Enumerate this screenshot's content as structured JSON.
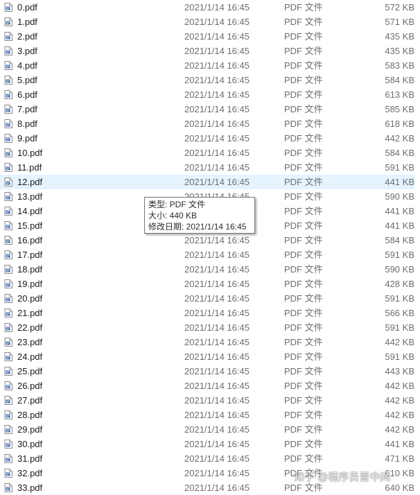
{
  "files": [
    {
      "name": "0.pdf",
      "date": "2021/1/14 16:45",
      "type": "PDF 文件",
      "size": "572 KB"
    },
    {
      "name": "1.pdf",
      "date": "2021/1/14 16:45",
      "type": "PDF 文件",
      "size": "571 KB"
    },
    {
      "name": "2.pdf",
      "date": "2021/1/14 16:45",
      "type": "PDF 文件",
      "size": "435 KB"
    },
    {
      "name": "3.pdf",
      "date": "2021/1/14 16:45",
      "type": "PDF 文件",
      "size": "435 KB"
    },
    {
      "name": "4.pdf",
      "date": "2021/1/14 16:45",
      "type": "PDF 文件",
      "size": "583 KB"
    },
    {
      "name": "5.pdf",
      "date": "2021/1/14 16:45",
      "type": "PDF 文件",
      "size": "584 KB"
    },
    {
      "name": "6.pdf",
      "date": "2021/1/14 16:45",
      "type": "PDF 文件",
      "size": "613 KB"
    },
    {
      "name": "7.pdf",
      "date": "2021/1/14 16:45",
      "type": "PDF 文件",
      "size": "585 KB"
    },
    {
      "name": "8.pdf",
      "date": "2021/1/14 16:45",
      "type": "PDF 文件",
      "size": "618 KB"
    },
    {
      "name": "9.pdf",
      "date": "2021/1/14 16:45",
      "type": "PDF 文件",
      "size": "442 KB"
    },
    {
      "name": "10.pdf",
      "date": "2021/1/14 16:45",
      "type": "PDF 文件",
      "size": "584 KB"
    },
    {
      "name": "11.pdf",
      "date": "2021/1/14 16:45",
      "type": "PDF 文件",
      "size": "591 KB"
    },
    {
      "name": "12.pdf",
      "date": "2021/1/14 16:45",
      "type": "PDF 文件",
      "size": "441 KB",
      "selected": true
    },
    {
      "name": "13.pdf",
      "date": "2021/1/14 16:45",
      "type": "PDF 文件",
      "size": "590 KB"
    },
    {
      "name": "14.pdf",
      "date": "2021/1/14 16:45",
      "type": "PDF 文件",
      "size": "441 KB"
    },
    {
      "name": "15.pdf",
      "date": "2021/1/14 16:45",
      "type": "PDF 文件",
      "size": "441 KB"
    },
    {
      "name": "16.pdf",
      "date": "2021/1/14 16:45",
      "type": "PDF 文件",
      "size": "584 KB"
    },
    {
      "name": "17.pdf",
      "date": "2021/1/14 16:45",
      "type": "PDF 文件",
      "size": "591 KB"
    },
    {
      "name": "18.pdf",
      "date": "2021/1/14 16:45",
      "type": "PDF 文件",
      "size": "590 KB"
    },
    {
      "name": "19.pdf",
      "date": "2021/1/14 16:45",
      "type": "PDF 文件",
      "size": "428 KB"
    },
    {
      "name": "20.pdf",
      "date": "2021/1/14 16:45",
      "type": "PDF 文件",
      "size": "591 KB"
    },
    {
      "name": "21.pdf",
      "date": "2021/1/14 16:45",
      "type": "PDF 文件",
      "size": "566 KB"
    },
    {
      "name": "22.pdf",
      "date": "2021/1/14 16:45",
      "type": "PDF 文件",
      "size": "591 KB"
    },
    {
      "name": "23.pdf",
      "date": "2021/1/14 16:45",
      "type": "PDF 文件",
      "size": "442 KB"
    },
    {
      "name": "24.pdf",
      "date": "2021/1/14 16:45",
      "type": "PDF 文件",
      "size": "591 KB"
    },
    {
      "name": "25.pdf",
      "date": "2021/1/14 16:45",
      "type": "PDF 文件",
      "size": "443 KB"
    },
    {
      "name": "26.pdf",
      "date": "2021/1/14 16:45",
      "type": "PDF 文件",
      "size": "442 KB"
    },
    {
      "name": "27.pdf",
      "date": "2021/1/14 16:45",
      "type": "PDF 文件",
      "size": "442 KB"
    },
    {
      "name": "28.pdf",
      "date": "2021/1/14 16:45",
      "type": "PDF 文件",
      "size": "442 KB"
    },
    {
      "name": "29.pdf",
      "date": "2021/1/14 16:45",
      "type": "PDF 文件",
      "size": "442 KB"
    },
    {
      "name": "30.pdf",
      "date": "2021/1/14 16:45",
      "type": "PDF 文件",
      "size": "441 KB"
    },
    {
      "name": "31.pdf",
      "date": "2021/1/14 16:45",
      "type": "PDF 文件",
      "size": "471 KB"
    },
    {
      "name": "32.pdf",
      "date": "2021/1/14 16:45",
      "type": "PDF 文件",
      "size": "610 KB"
    },
    {
      "name": "33.pdf",
      "date": "2021/1/14 16:45",
      "type": "PDF 文件",
      "size": "640 KB"
    }
  ],
  "file_icon": "pdf-file-icon",
  "tooltip": {
    "type_line": "类型: PDF 文件",
    "size_line": "大小: 440 KB",
    "modified_line": "修改日期: 2021/1/14 16:45"
  },
  "watermark": "知乎 @程序员晋中间",
  "colors": {
    "selected_row": "#e5f3ff",
    "secondary_text": "#6d6d6d",
    "icon_accent": "#2f5fa8"
  }
}
